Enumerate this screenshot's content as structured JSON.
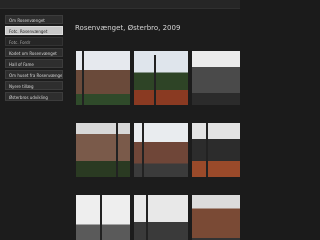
{
  "sidebar": {
    "items": [
      {
        "label": "Om Rosenvænget",
        "state": "normal"
      },
      {
        "label": "Fotc. Rosenvænget",
        "state": "active"
      },
      {
        "label": "Fotc. Fordr",
        "state": "sub"
      },
      {
        "label": "Kodet om Rosenvænget",
        "state": "normal"
      },
      {
        "label": "Hall of Fame",
        "state": "normal"
      },
      {
        "label": "Om huset fra Rosenvænget",
        "state": "normal"
      },
      {
        "label": "Nyere tillæg",
        "state": "normal"
      },
      {
        "label": "Østerbros udvikling",
        "state": "normal"
      }
    ]
  },
  "main": {
    "title": "Rosenvænget, Østerbro, 2009"
  },
  "gallery": {
    "photo_count": 9
  }
}
